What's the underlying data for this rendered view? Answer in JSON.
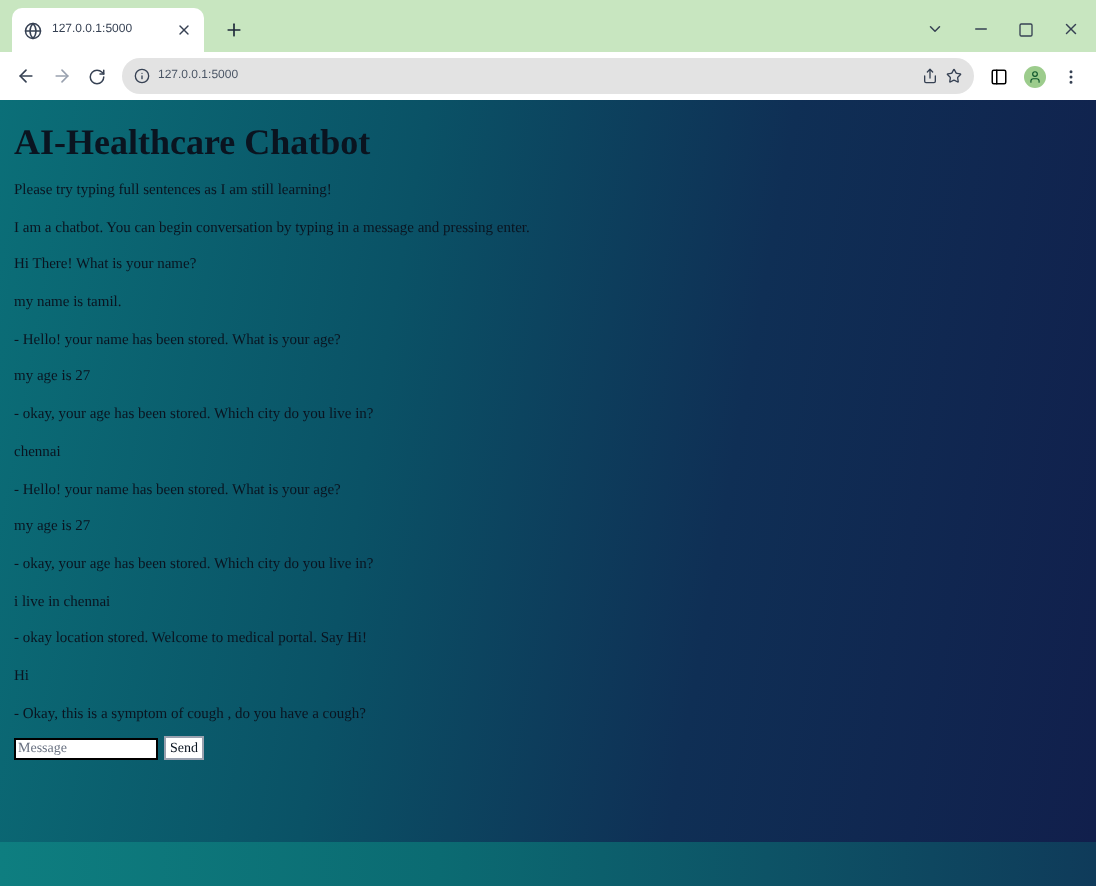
{
  "browser": {
    "tab_title": "127.0.0.1:5000",
    "url": "127.0.0.1:5000"
  },
  "page": {
    "title": "AI-Healthcare Chatbot",
    "messages": [
      "Please try typing full sentences as I am still learning!",
      "I am a chatbot. You can begin conversation by typing in a message and pressing enter.",
      "Hi There! What is your name?",
      "my name is tamil.",
      "- Hello! your name has been stored. What is your age?",
      "my age is 27",
      "- okay, your age has been stored. Which city do you live in?",
      "chennai",
      "- Hello! your name has been stored. What is your age?",
      "my age is 27",
      "- okay, your age has been stored. Which city do you live in?",
      "i live in chennai",
      "- okay location stored. Welcome to medical portal. Say Hi!",
      "Hi",
      "- Okay, this is a symptom of cough , do you have a cough?"
    ],
    "input": {
      "placeholder": "Message"
    },
    "send_button": "Send"
  }
}
